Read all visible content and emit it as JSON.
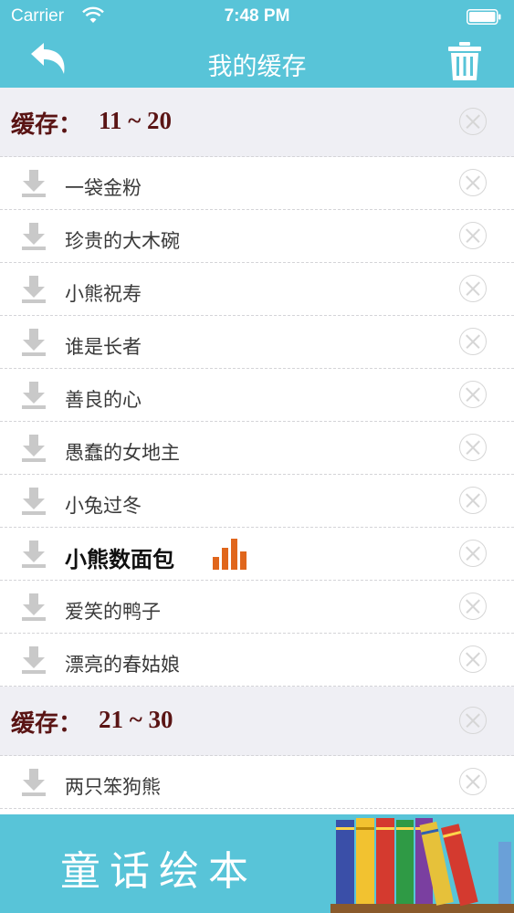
{
  "status_bar": {
    "carrier": "Carrier",
    "time": "7:48 PM"
  },
  "nav": {
    "title": "我的缓存"
  },
  "sections": [
    {
      "label": "缓存：",
      "range": "11 ~ 20",
      "items": [
        {
          "title": "一袋金粉"
        },
        {
          "title": "珍贵的大木碗"
        },
        {
          "title": "小熊祝寿"
        },
        {
          "title": "谁是长者"
        },
        {
          "title": "善良的心"
        },
        {
          "title": "愚蠢的女地主"
        },
        {
          "title": "小兔过冬"
        },
        {
          "title": "小熊数面包",
          "playing": true
        },
        {
          "title": "爱笑的鸭子"
        },
        {
          "title": "漂亮的春姑娘"
        }
      ]
    },
    {
      "label": "缓存：",
      "range": "21 ~ 30",
      "items": [
        {
          "title": "两只笨狗熊"
        }
      ]
    }
  ],
  "banner": {
    "text": "童话绘本"
  },
  "colors": {
    "accent": "#58c4d8",
    "section_text": "#5a1414",
    "playing_bars": "#e0661c",
    "section_bg": "#efeff4"
  }
}
